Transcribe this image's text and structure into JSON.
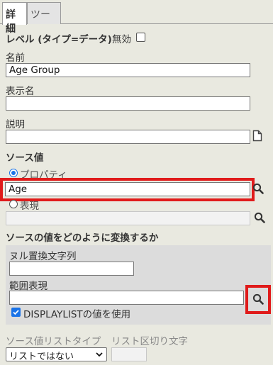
{
  "tabs": [
    {
      "label": "詳細",
      "active": true
    },
    {
      "label": "ツール",
      "active": false
    }
  ],
  "level": {
    "label": "レベル (タイプ=データ)",
    "disabled_label": "無効",
    "disabled_checked": false
  },
  "name": {
    "label": "名前",
    "value": "Age Group"
  },
  "display_name": {
    "label": "表示名",
    "value": ""
  },
  "description": {
    "label": "説明",
    "value": ""
  },
  "source_value": {
    "heading": "ソース値",
    "property_label": "プロパティ",
    "property_value": "Age",
    "expression_label": "表現",
    "expression_value": "",
    "selected": "property"
  },
  "transform": {
    "heading": "ソースの値をどのように変換するか",
    "null_replace_label": "ヌル置換文字列",
    "null_replace_value": "",
    "range_expr_label": "範囲表現",
    "range_expr_value": "",
    "displaylist_label": "DISPLAYLISTの値を使用",
    "displaylist_checked": true
  },
  "list_type": {
    "label": "ソース値リストタイプ",
    "separator_label": "リスト区切り文字",
    "selected": "リストではない",
    "separator_value": ""
  },
  "icons": {
    "search": "search-icon",
    "document": "document-icon",
    "highlight_color": "#e01b1b"
  }
}
